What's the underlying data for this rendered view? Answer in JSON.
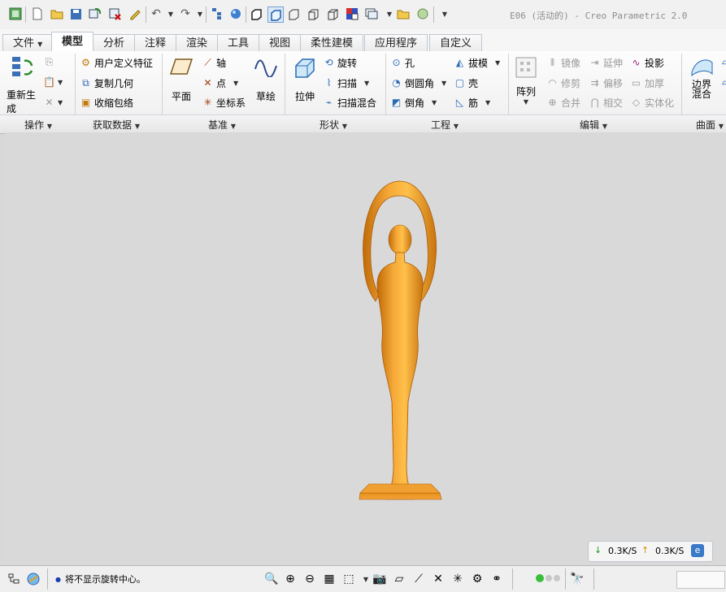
{
  "window": {
    "title": "E06 (活动的) - Creo Parametric 2.0"
  },
  "tabs": [
    "文件",
    "模型",
    "分析",
    "注释",
    "渲染",
    "工具",
    "视图",
    "柔性建模",
    "应用程序",
    "自定义"
  ],
  "ribbon": {
    "regenerate": "重新生成",
    "user_feature": "用户定义特征",
    "copy_geometry": "复制几何",
    "shrinkwrap": "收缩包络",
    "plane": "平面",
    "axis": "轴",
    "point": "点",
    "csys": "坐标系",
    "sketch": "草绘",
    "extrude": "拉伸",
    "revolve": "旋转",
    "sweep": "扫描",
    "swept_blend": "扫描混合",
    "hole": "孔",
    "round": "倒圆角",
    "chamfer": "倒角",
    "draft": "拔模",
    "shell": "壳",
    "rib": "筋",
    "pattern": "阵列",
    "mirror": "镜像",
    "trim": "修剪",
    "merge": "合并",
    "extend": "延伸",
    "offset": "偏移",
    "intersect": "相交",
    "project": "投影",
    "thicken": "加厚",
    "solidify": "实体化",
    "boundary_blend": "边界混合"
  },
  "groups": [
    "操作",
    "获取数据",
    "基准",
    "形状",
    "工程",
    "编辑",
    "曲面"
  ],
  "status": {
    "message": "将不显示旋转中心。"
  },
  "network": {
    "down": "0.3K/S",
    "up": "0.3K/S"
  },
  "colors": {
    "model": "#f0a028",
    "background": "#d9d9d9"
  }
}
